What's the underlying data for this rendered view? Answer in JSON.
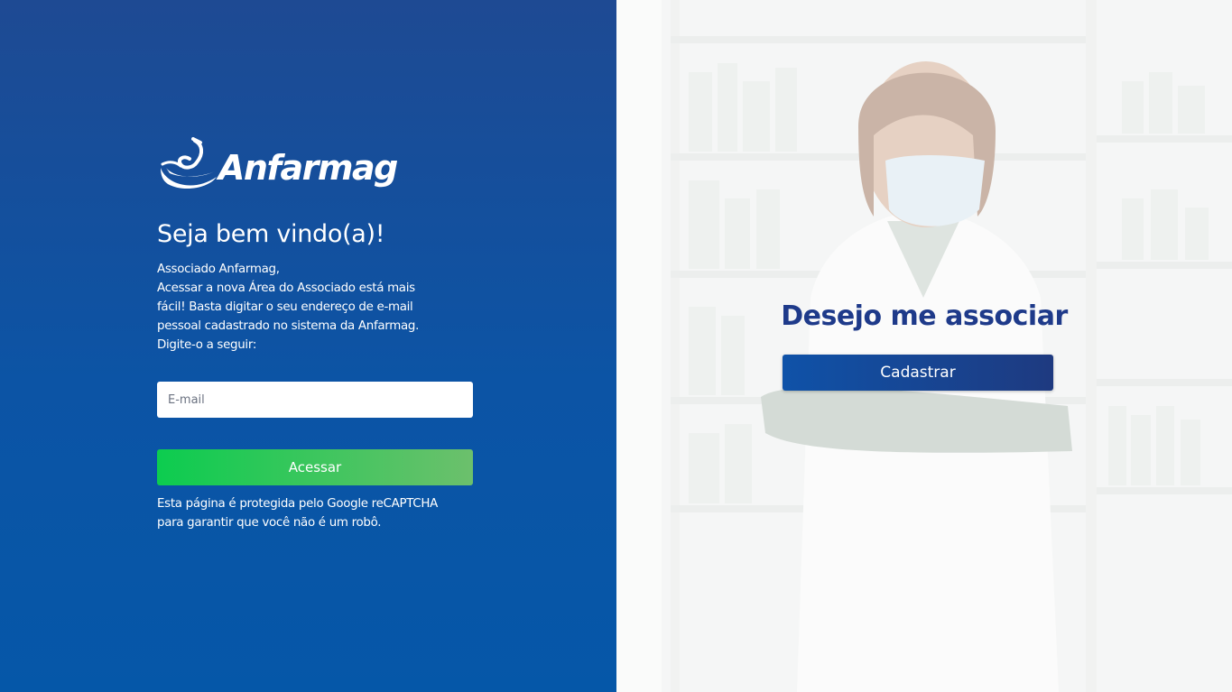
{
  "brand": {
    "name": "Anfarmag",
    "logo_icon": "mortar-pestle-icon",
    "left_gradient_top": "#1e4a93",
    "left_gradient_bottom": "#0557a8",
    "accent_green": "#0ccc4f",
    "title_blue": "#1e3a8a"
  },
  "login": {
    "title": "Seja bem vindo(a)!",
    "intro_lines": [
      "Associado Anfarmag,",
      "Acessar a nova Área do Associado está mais",
      "fácil! Basta digitar o seu endereço de e-mail",
      "pessoal cadastrado no sistema da Anfarmag.",
      "Digite-o a seguir:"
    ],
    "email_placeholder": "E-mail",
    "email_value": "",
    "submit_label": "Acessar",
    "recaptcha_lines": [
      "Esta página é protegida pelo Google reCAPTCHA",
      "para garantir que você não é um robô."
    ]
  },
  "join": {
    "title": "Desejo me associar",
    "button_label": "Cadastrar",
    "background_image": "pharmacist-photo"
  }
}
